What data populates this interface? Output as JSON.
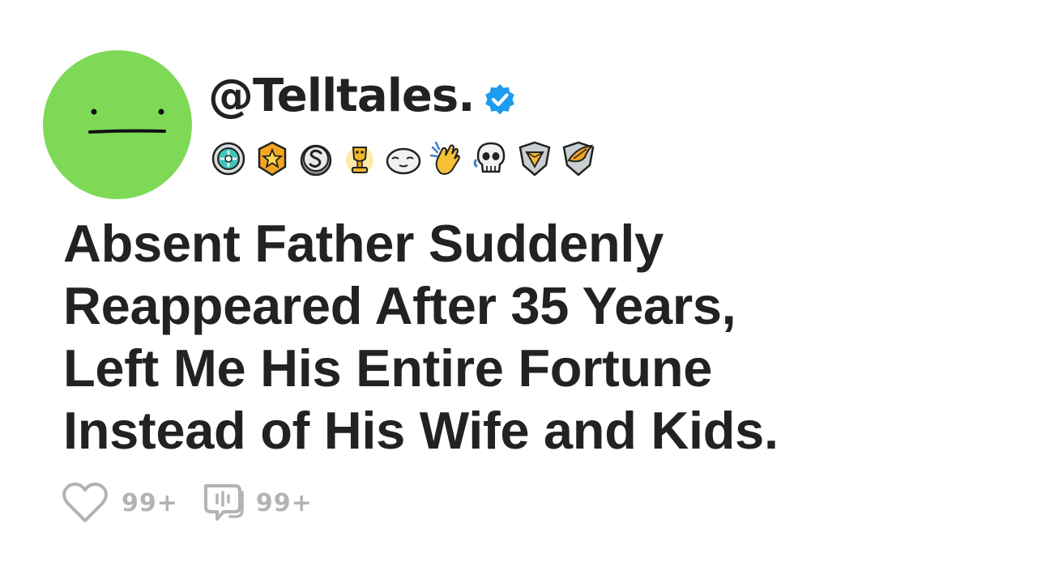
{
  "post": {
    "username": "@Telltales.",
    "verified": true,
    "title_lines": [
      "Absent Father Suddenly",
      "Reappeared After 35 Years,",
      "Left Me His Entire Fortune",
      "Instead of His Wife and Kids."
    ],
    "stats": {
      "likes": "99+",
      "comments": "99+"
    }
  },
  "colors": {
    "avatar": "#7ed957",
    "verified": "#1d9bf0",
    "text": "#222222",
    "stat": "#b3b3b3"
  },
  "icons": {
    "avatar_face": "neutral-face-icon",
    "verified": "verified-check-icon",
    "badges": [
      "gem-badge-icon",
      "star-badge-icon",
      "s-coin-badge-icon",
      "gold-trophy-badge-icon",
      "seal-badge-icon",
      "clapping-hands-badge-icon",
      "laughing-skull-badge-icon",
      "diamond-shield-badge-icon",
      "wing-shield-badge-icon"
    ],
    "like": "heart-icon",
    "comment": "comment-icon"
  }
}
